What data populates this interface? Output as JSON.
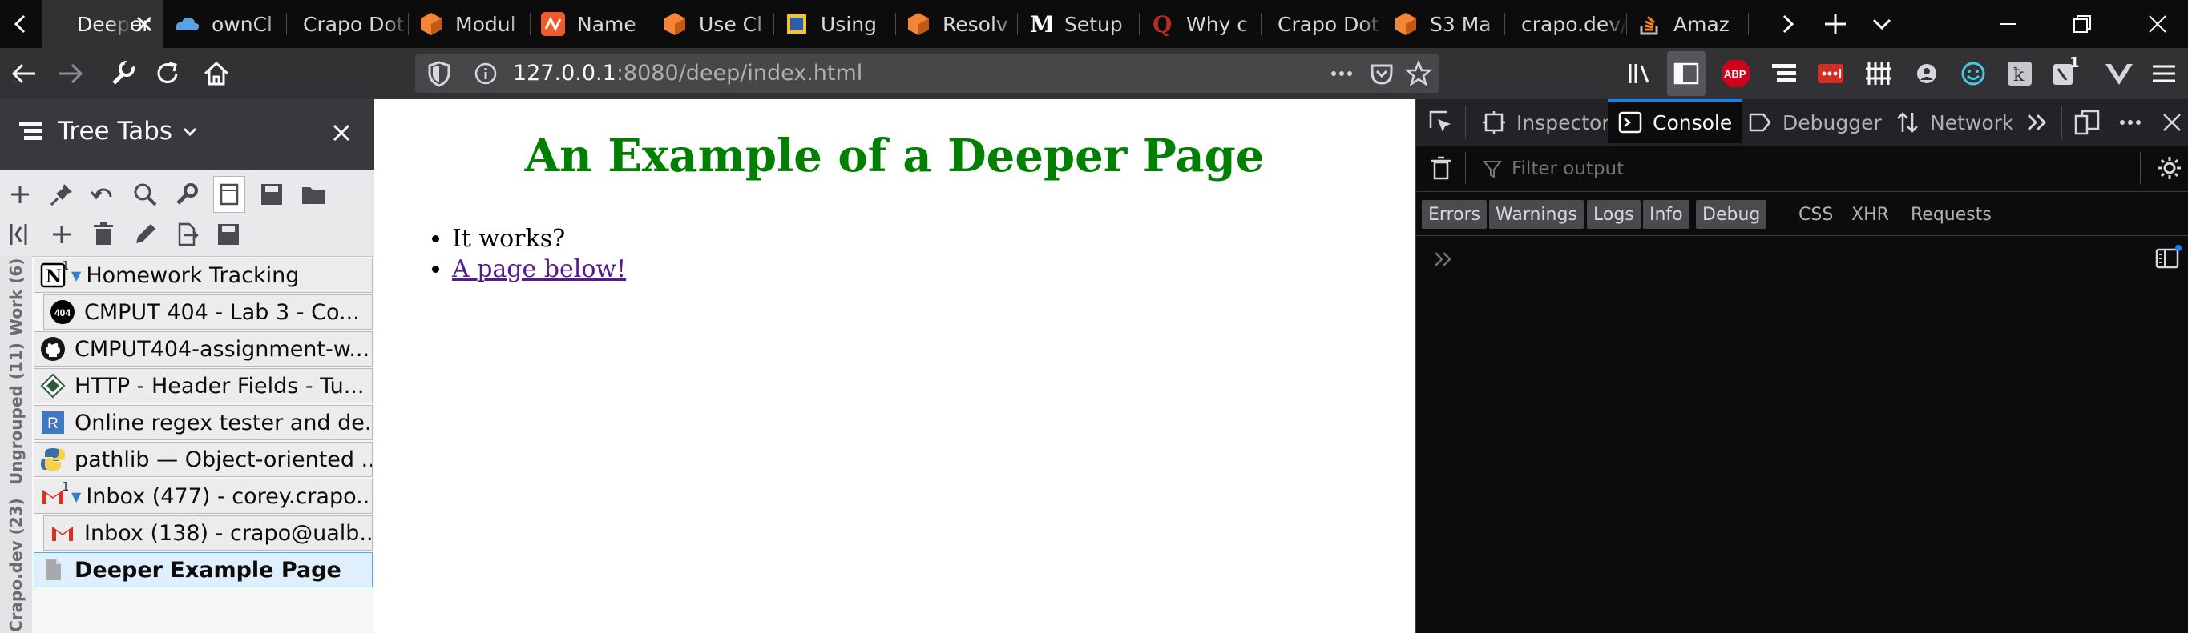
{
  "tabs": [
    {
      "label": "Deeper",
      "active": true
    },
    {
      "label": "ownCl"
    },
    {
      "label": "Crapo Dot"
    },
    {
      "label": "Modul"
    },
    {
      "label": "Name"
    },
    {
      "label": "Use Cl"
    },
    {
      "label": "Using"
    },
    {
      "label": "Resolv"
    },
    {
      "label": "Setup"
    },
    {
      "label": "Why c"
    },
    {
      "label": "Crapo Dot"
    },
    {
      "label": "S3 Ma"
    },
    {
      "label": "crapo.dev/"
    },
    {
      "label": "Amaz"
    }
  ],
  "navbar": {
    "url_host": "127.0.0.1",
    "url_rest": ":8080/deep/index.html",
    "badge_count": "1"
  },
  "sidebar": {
    "title": "Tree Tabs",
    "groups": [
      "Work (6)",
      "Ungrouped (11)",
      "Crapo.dev (23)"
    ],
    "items": [
      {
        "label": "Homework Tracking",
        "indicator": "1"
      },
      {
        "label": "CMPUT 404 - Lab 3 - Co...",
        "favicon": "404"
      },
      {
        "label": "CMPUT404-assignment-w..."
      },
      {
        "label": "HTTP - Header Fields - Tu..."
      },
      {
        "label": "Online regex tester and de...",
        "favicon": "R"
      },
      {
        "label": "pathlib — Object-oriented ..."
      },
      {
        "label": "Inbox (477) - corey.crapo...",
        "indicator": "1"
      },
      {
        "label": "Inbox (138) - crapo@ualb..."
      },
      {
        "label": "Deeper Example Page"
      }
    ]
  },
  "page": {
    "title": "An Example of a Deeper Page",
    "items": [
      "It works?",
      "A page below!"
    ]
  },
  "devtools": {
    "tabs": [
      "Inspector",
      "Console",
      "Debugger",
      "Network"
    ],
    "filter_placeholder": "Filter output",
    "categories": [
      "Errors",
      "Warnings",
      "Logs",
      "Info",
      "Debug",
      "CSS",
      "XHR",
      "Requests"
    ]
  }
}
